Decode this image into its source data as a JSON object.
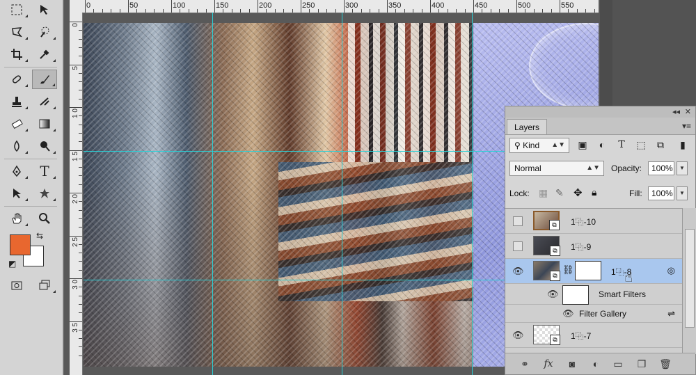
{
  "rulers": {
    "top_labels": [
      "0",
      "50",
      "100",
      "150",
      "200",
      "250",
      "300",
      "350",
      "400",
      "450",
      "500",
      "550"
    ],
    "left_labels": [
      "0",
      "5",
      "1 0",
      "1 5",
      "2 0",
      "2 5",
      "3 0",
      "3 5"
    ]
  },
  "toolbar": {
    "colors": {
      "foreground": "#e8672f",
      "background": "#ffffff"
    }
  },
  "layers_panel": {
    "tab": "Layers",
    "filter": {
      "kind_label": "Kind"
    },
    "blend_mode": "Normal",
    "opacity_label": "Opacity:",
    "opacity_value": "100%",
    "lock_label": "Lock:",
    "fill_label": "Fill:",
    "fill_value": "100%",
    "layers": [
      {
        "name": "1⿻-10",
        "visible": false
      },
      {
        "name": "1⿻-9",
        "visible": false
      },
      {
        "name": "1⿻-8",
        "visible": true,
        "selected": true
      },
      {
        "name": "Smart Filters",
        "sub": true
      },
      {
        "name": "Filter Gallery",
        "sub": true
      },
      {
        "name": "1⿻-7",
        "visible": true
      }
    ]
  }
}
